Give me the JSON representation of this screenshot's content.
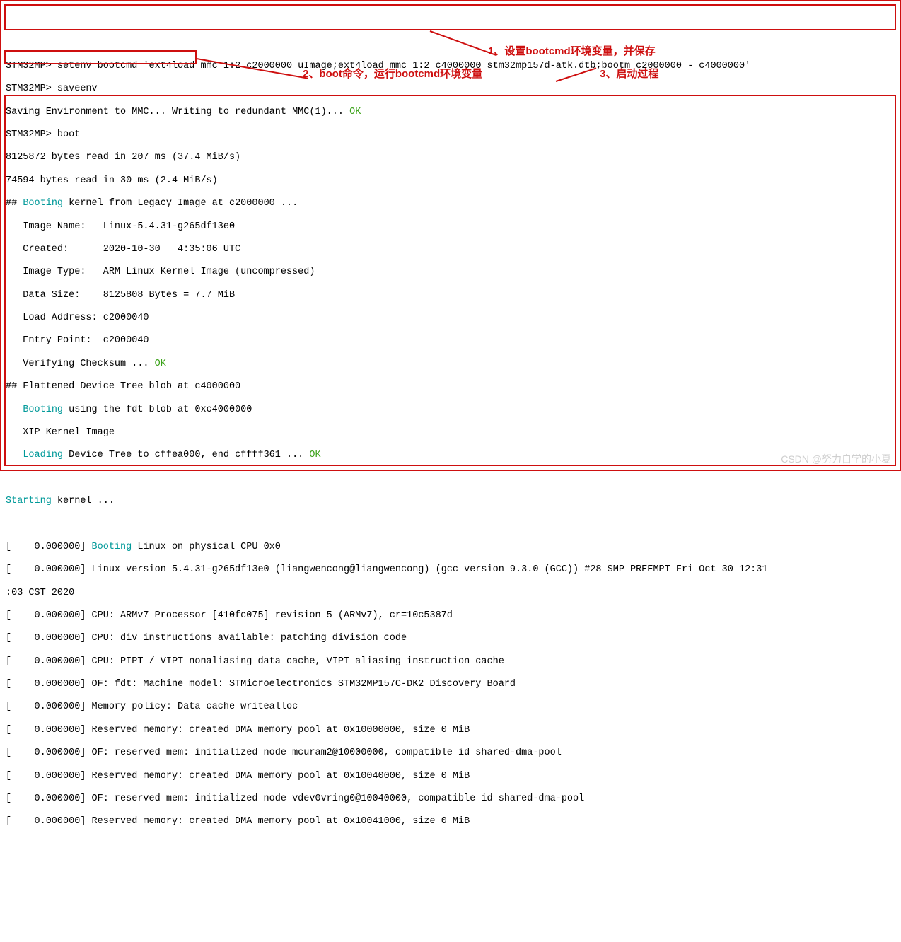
{
  "prompt": "STM32MP>",
  "commands": {
    "setenv": "setenv bootcmd 'ext4load mmc 1:2 c2000000 uImage;ext4load mmc 1:2 c4000000 stm32mp157d-atk.dtb;bootm c2000000 - c4000000'",
    "saveenv": "saveenv",
    "boot": "boot"
  },
  "output": {
    "save_env_prefix": "Saving Environment to MMC... Writing to redundant MMC(1)... ",
    "save_env_ok": "OK",
    "read1": "8125872 bytes read in 207 ms (37.4 MiB/s)",
    "read2": "74594 bytes read in 30 ms (2.4 MiB/s)",
    "booting_prefix": "## ",
    "booting_word": "Booting",
    "booting_suffix": " kernel from Legacy Image at c2000000 ...",
    "image_name": "   Image Name:   Linux-5.4.31-g265df13e0",
    "created": "   Created:      2020-10-30   4:35:06 UTC",
    "image_type": "   Image Type:   ARM Linux Kernel Image (uncompressed)",
    "data_size": "   Data Size:    8125808 Bytes = 7.7 MiB",
    "load_addr": "   Load Address: c2000040",
    "entry_point": "   Entry Point:  c2000040",
    "verify": "   Verifying Checksum ... ",
    "verify_ok": "OK",
    "fdt_header": "## Flattened Device Tree blob at c4000000",
    "fdt_booting_pre": "   ",
    "fdt_booting_word": "Booting",
    "fdt_booting_suf": " using the fdt blob at 0xc4000000",
    "xip": "   XIP Kernel Image",
    "loading_pre": "   ",
    "loading_word": "Loading",
    "loading_suf": " Device Tree to cffea000, end cffff361 ... ",
    "loading_ok": "OK",
    "starting_word": "Starting",
    "starting_suf": " kernel ...",
    "boot_linux_prefix": "[    0.000000] ",
    "boot_linux_word": "Booting",
    "boot_linux_suf": " Linux on physical CPU 0x0",
    "kernel_lines": [
      "[    0.000000] Linux version 5.4.31-g265df13e0 (liangwencong@liangwencong) (gcc version 9.3.0 (GCC)) #28 SMP PREEMPT Fri Oct 30 12:31",
      ":03 CST 2020",
      "[    0.000000] CPU: ARMv7 Processor [410fc075] revision 5 (ARMv7), cr=10c5387d",
      "[    0.000000] CPU: div instructions available: patching division code",
      "[    0.000000] CPU: PIPT / VIPT nonaliasing data cache, VIPT aliasing instruction cache",
      "[    0.000000] OF: fdt: Machine model: STMicroelectronics STM32MP157C-DK2 Discovery Board",
      "[    0.000000] Memory policy: Data cache writealloc",
      "[    0.000000] Reserved memory: created DMA memory pool at 0x10000000, size 0 MiB",
      "[    0.000000] OF: reserved mem: initialized node mcuram2@10000000, compatible id shared-dma-pool",
      "[    0.000000] Reserved memory: created DMA memory pool at 0x10040000, size 0 MiB",
      "[    0.000000] OF: reserved mem: initialized node vdev0vring0@10040000, compatible id shared-dma-pool",
      "[    0.000000] Reserved memory: created DMA memory pool at 0x10041000, size 0 MiB"
    ]
  },
  "annotations": {
    "a1": "1、设置bootcmd环境变量，并保存",
    "a2": "2、boot命令，运行bootcmd环境变量",
    "a3": "3、启动过程"
  },
  "watermark": "CSDN @努力自学的小夏"
}
